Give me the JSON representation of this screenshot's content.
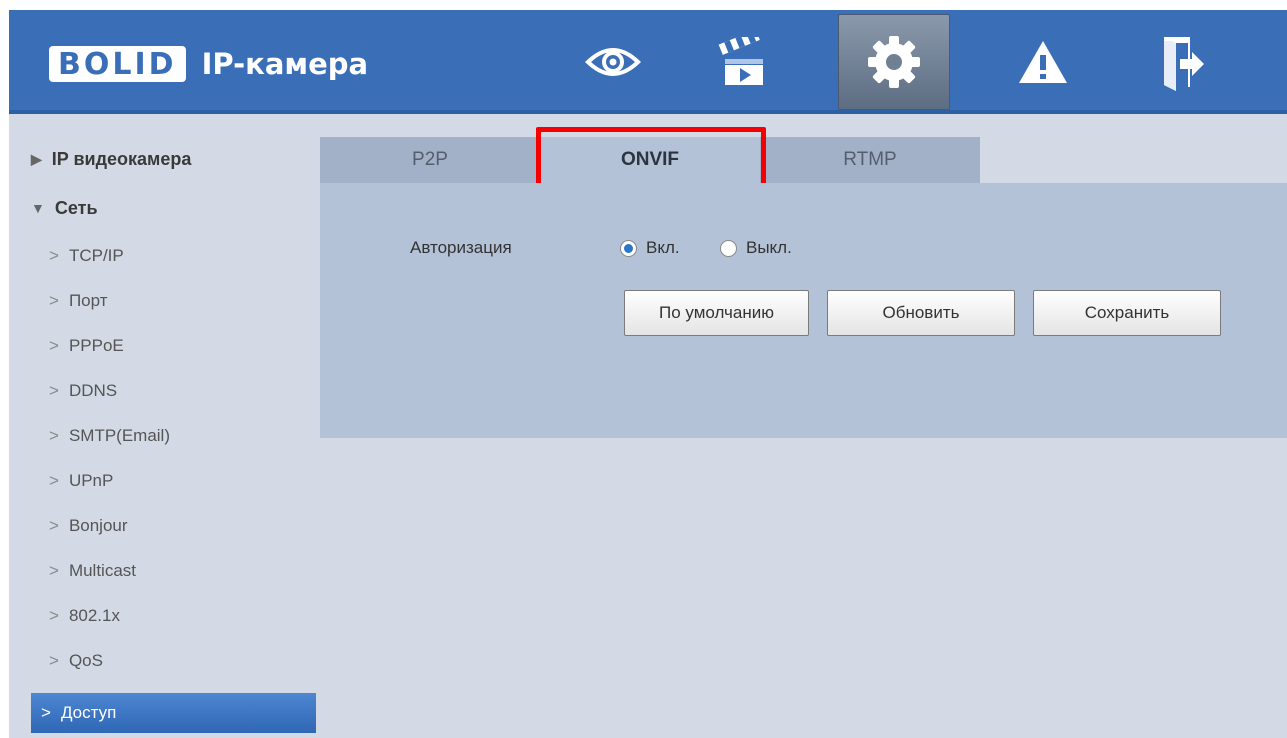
{
  "header": {
    "logo": "BOLID",
    "title": "IP-камера",
    "nav": [
      {
        "name": "live-view",
        "icon": "eye-icon"
      },
      {
        "name": "playback",
        "icon": "clapperboard-icon"
      },
      {
        "name": "settings",
        "icon": "gear-icon",
        "active": true
      },
      {
        "name": "alarm",
        "icon": "warning-icon"
      },
      {
        "name": "logout",
        "icon": "exit-door-icon"
      }
    ]
  },
  "sidebar": {
    "groups": [
      {
        "label": "IP видеокамера",
        "expanded": false
      },
      {
        "label": "Сеть",
        "expanded": true
      }
    ],
    "items": [
      {
        "label": "TCP/IP"
      },
      {
        "label": "Порт"
      },
      {
        "label": "PPPoE"
      },
      {
        "label": "DDNS"
      },
      {
        "label": "SMTP(Email)"
      },
      {
        "label": "UPnP"
      },
      {
        "label": "Bonjour"
      },
      {
        "label": "Multicast"
      },
      {
        "label": "802.1x"
      },
      {
        "label": "QoS"
      },
      {
        "label": "Доступ",
        "selected": true
      }
    ],
    "chevron": ">",
    "arrow_collapsed": "▶",
    "arrow_expanded": "▼"
  },
  "tabs": [
    {
      "label": "P2P"
    },
    {
      "label": "ONVIF",
      "active": true
    },
    {
      "label": "RTMP"
    }
  ],
  "form": {
    "auth_label": "Авторизация",
    "option_on": "Вкл.",
    "option_off": "Выкл.",
    "selected": "on",
    "buttons": {
      "default": "По умолчанию",
      "refresh": "Обновить",
      "save": "Сохранить"
    }
  },
  "colors": {
    "header_bg": "#3a6fb8",
    "highlight": "#f40000",
    "selected_item": "#3b73c2"
  }
}
